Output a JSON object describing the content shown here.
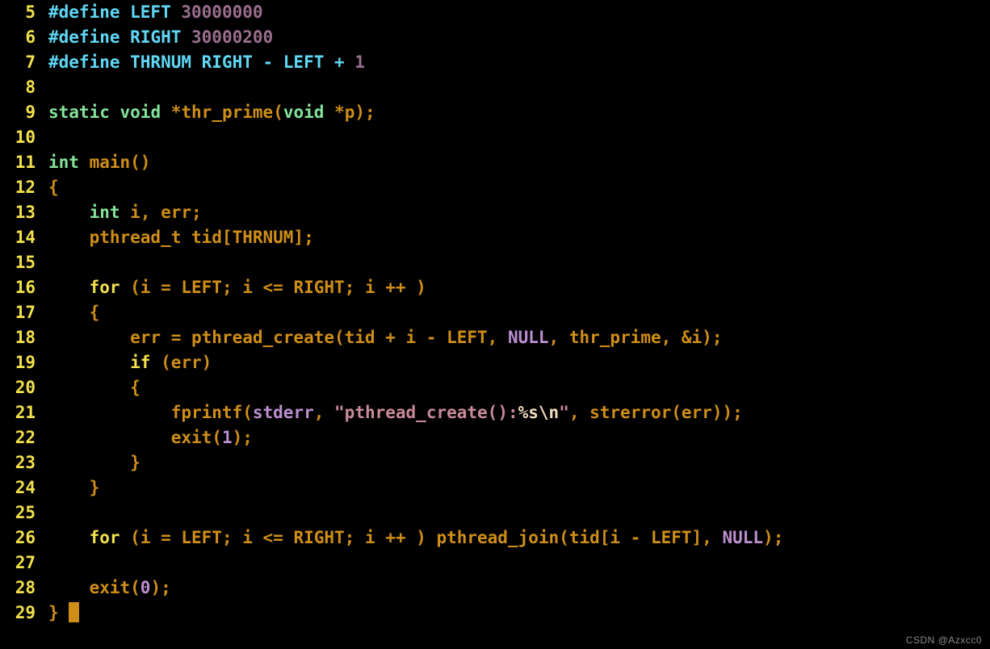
{
  "editor": {
    "background_color": "#000000",
    "gutter_color": "#f2e14c",
    "default_text_color": "#cf8e17",
    "cursor_color": "#cf8e17",
    "first_line_number": 5,
    "last_line_number": 29,
    "language": "C"
  },
  "palette": {
    "preprocessor": "#5fd7f5",
    "number": "#9a6e8e",
    "type": "#84e39a",
    "keyword": "#f2e14c",
    "string": "#c98a9b",
    "escape": "#f0dcc0",
    "constant": "#bb8fd0",
    "identifier": "#cf8e17",
    "line_number": "#f2e14c"
  },
  "lines": [
    {
      "number": "5",
      "text": "#define LEFT 30000000",
      "tokens": [
        {
          "text": "#define LEFT ",
          "kind": "preproc"
        },
        {
          "text": "30000000",
          "kind": "number"
        }
      ]
    },
    {
      "number": "6",
      "text": "#define RIGHT 30000200",
      "tokens": [
        {
          "text": "#define RIGHT ",
          "kind": "preproc"
        },
        {
          "text": "30000200",
          "kind": "number"
        }
      ]
    },
    {
      "number": "7",
      "text": "#define THRNUM RIGHT - LEFT + 1",
      "tokens": [
        {
          "text": "#define THRNUM RIGHT - LEFT + ",
          "kind": "preproc"
        },
        {
          "text": "1",
          "kind": "number"
        }
      ]
    },
    {
      "number": "8",
      "text": "",
      "tokens": []
    },
    {
      "number": "9",
      "text": "static void *thr_prime(void *p);",
      "tokens": [
        {
          "text": "static",
          "kind": "type"
        },
        {
          "text": " ",
          "kind": "default"
        },
        {
          "text": "void",
          "kind": "type"
        },
        {
          "text": " *",
          "kind": "default"
        },
        {
          "text": "thr_prime",
          "kind": "ident"
        },
        {
          "text": "(",
          "kind": "punct"
        },
        {
          "text": "void",
          "kind": "type"
        },
        {
          "text": " *p);",
          "kind": "default"
        }
      ]
    },
    {
      "number": "10",
      "text": "",
      "tokens": []
    },
    {
      "number": "11",
      "text": "int main()",
      "tokens": [
        {
          "text": "int",
          "kind": "type"
        },
        {
          "text": " ",
          "kind": "default"
        },
        {
          "text": "main()",
          "kind": "ident"
        }
      ]
    },
    {
      "number": "12",
      "text": "{",
      "tokens": [
        {
          "text": "{",
          "kind": "punct"
        }
      ]
    },
    {
      "number": "13",
      "text": "    int i, err;",
      "tokens": [
        {
          "text": "    ",
          "kind": "default"
        },
        {
          "text": "int",
          "kind": "type"
        },
        {
          "text": " i, err;",
          "kind": "default"
        }
      ]
    },
    {
      "number": "14",
      "text": "    pthread_t tid[THRNUM];",
      "tokens": [
        {
          "text": "    pthread_t tid[THRNUM];",
          "kind": "default"
        }
      ]
    },
    {
      "number": "15",
      "text": "",
      "tokens": []
    },
    {
      "number": "16",
      "text": "    for (i = LEFT; i <= RIGHT; i ++ )",
      "tokens": [
        {
          "text": "    ",
          "kind": "default"
        },
        {
          "text": "for",
          "kind": "keyword"
        },
        {
          "text": " (i = LEFT; i <= RIGHT; i ++ )",
          "kind": "default"
        }
      ]
    },
    {
      "number": "17",
      "text": "    {",
      "tokens": [
        {
          "text": "    {",
          "kind": "punct"
        }
      ]
    },
    {
      "number": "18",
      "text": "        err = pthread_create(tid + i - LEFT, NULL, thr_prime, &i);",
      "tokens": [
        {
          "text": "        err = pthread_create(tid + i - LEFT, ",
          "kind": "default"
        },
        {
          "text": "NULL",
          "kind": "const"
        },
        {
          "text": ", thr_prime, &i);",
          "kind": "default"
        }
      ]
    },
    {
      "number": "19",
      "text": "        if (err)",
      "tokens": [
        {
          "text": "        ",
          "kind": "default"
        },
        {
          "text": "if",
          "kind": "keyword"
        },
        {
          "text": " (err)",
          "kind": "default"
        }
      ]
    },
    {
      "number": "20",
      "text": "        {",
      "tokens": [
        {
          "text": "        {",
          "kind": "punct"
        }
      ]
    },
    {
      "number": "21",
      "text": "            fprintf(stderr, \"pthread_create():%s\\n\", strerror(err));",
      "tokens": [
        {
          "text": "            fprintf(",
          "kind": "default"
        },
        {
          "text": "stderr",
          "kind": "const"
        },
        {
          "text": ", ",
          "kind": "default"
        },
        {
          "text": "\"pthread_create():",
          "kind": "string"
        },
        {
          "text": "%s\\n",
          "kind": "escape"
        },
        {
          "text": "\"",
          "kind": "string"
        },
        {
          "text": ", strerror(err));",
          "kind": "default"
        }
      ]
    },
    {
      "number": "22",
      "text": "            exit(1);",
      "tokens": [
        {
          "text": "            exit(",
          "kind": "default"
        },
        {
          "text": "1",
          "kind": "const"
        },
        {
          "text": ");",
          "kind": "default"
        }
      ]
    },
    {
      "number": "23",
      "text": "        }",
      "tokens": [
        {
          "text": "        }",
          "kind": "punct"
        }
      ]
    },
    {
      "number": "24",
      "text": "    }",
      "tokens": [
        {
          "text": "    }",
          "kind": "punct"
        }
      ]
    },
    {
      "number": "25",
      "text": "",
      "tokens": []
    },
    {
      "number": "26",
      "text": "    for (i = LEFT; i <= RIGHT; i ++ ) pthread_join(tid[i - LEFT], NULL);",
      "tokens": [
        {
          "text": "    ",
          "kind": "default"
        },
        {
          "text": "for",
          "kind": "keyword"
        },
        {
          "text": " (i = LEFT; i <= RIGHT; i ++ ) pthread_join(tid[i - LEFT], ",
          "kind": "default"
        },
        {
          "text": "NULL",
          "kind": "const"
        },
        {
          "text": ");",
          "kind": "default"
        }
      ]
    },
    {
      "number": "27",
      "text": "",
      "tokens": []
    },
    {
      "number": "28",
      "text": "    exit(0);",
      "tokens": [
        {
          "text": "    exit(",
          "kind": "default"
        },
        {
          "text": "0",
          "kind": "const"
        },
        {
          "text": ");",
          "kind": "default"
        }
      ]
    },
    {
      "number": "29",
      "text": "}",
      "tokens": [
        {
          "text": "}",
          "kind": "punct"
        }
      ],
      "cursor_after": true
    }
  ],
  "watermark": {
    "text": "CSDN @Azxcc0"
  }
}
